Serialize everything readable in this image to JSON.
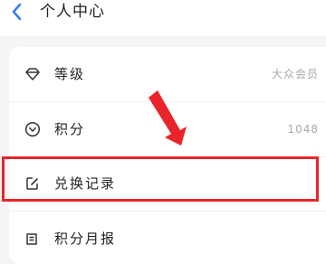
{
  "header": {
    "title": "个人中心"
  },
  "menu": {
    "items": [
      {
        "label": "等级",
        "value": "大众会员",
        "icon": "diamond-icon"
      },
      {
        "label": "积分",
        "value": "1048",
        "icon": "circle-chevron-icon"
      },
      {
        "label": "兑换记录",
        "value": "",
        "icon": "edit-note-icon"
      },
      {
        "label": "积分月报",
        "value": "",
        "icon": "report-icon"
      }
    ]
  },
  "annotation": {
    "highlight_color": "#e9242a",
    "highlighted_item": "兑换记录"
  },
  "colors": {
    "background": "#f5f5f7",
    "card": "#ffffff",
    "accent": "#3b7cf6",
    "text_primary": "#222222",
    "text_secondary": "#a8a8a8"
  }
}
